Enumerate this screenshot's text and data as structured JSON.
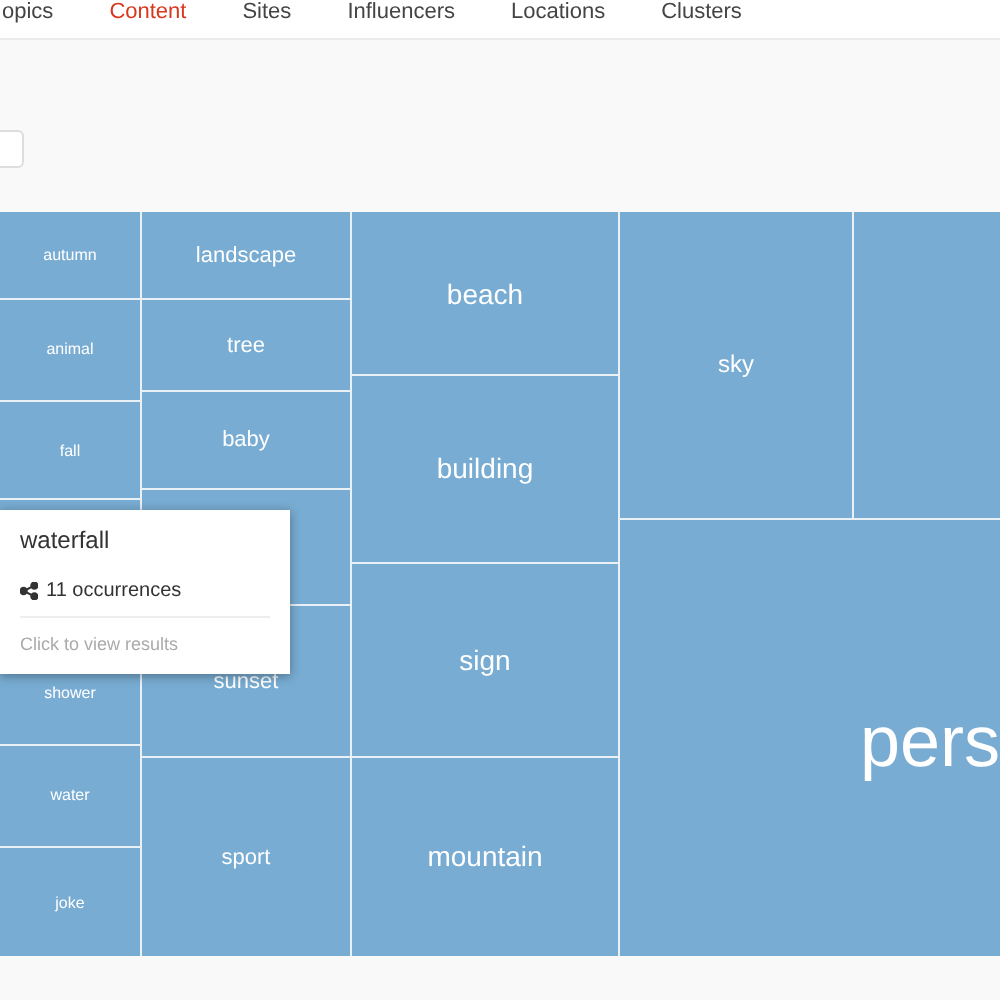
{
  "nav": {
    "tabs": [
      {
        "label": "opics",
        "selected": false
      },
      {
        "label": "Content",
        "selected": true
      },
      {
        "label": "Sites",
        "selected": false
      },
      {
        "label": "Influencers",
        "selected": false
      },
      {
        "label": "Locations",
        "selected": false
      },
      {
        "label": "Clusters",
        "selected": false
      }
    ]
  },
  "treemap": {
    "columns": [
      {
        "tiles": [
          {
            "kind": "label",
            "label": "autumn"
          },
          {
            "kind": "label",
            "label": "animal"
          },
          {
            "kind": "label",
            "label": "fall"
          },
          {
            "kind": "label",
            "label": "shower"
          },
          {
            "kind": "label",
            "label": "water"
          },
          {
            "kind": "label",
            "label": "joke"
          }
        ]
      },
      {
        "tiles": [
          {
            "kind": "label",
            "label": "landscape"
          },
          {
            "kind": "label",
            "label": "tree"
          },
          {
            "kind": "label",
            "label": "baby"
          },
          {
            "kind": "blank"
          },
          {
            "kind": "label",
            "label": "sunset"
          },
          {
            "kind": "label",
            "label": "sport"
          }
        ]
      },
      {
        "tiles": [
          {
            "kind": "label",
            "label": "beach"
          },
          {
            "kind": "label",
            "label": "building"
          },
          {
            "kind": "label",
            "label": "sign"
          },
          {
            "kind": "label",
            "label": "mountain"
          }
        ]
      }
    ],
    "top_row": [
      {
        "kind": "label",
        "label": "sky"
      },
      {
        "kind": "blank"
      }
    ],
    "bottom": {
      "kind": "label",
      "label": "pers"
    }
  },
  "tooltip": {
    "title": "waterfall",
    "count": "11 occurrences",
    "hint": "Click to view results"
  }
}
